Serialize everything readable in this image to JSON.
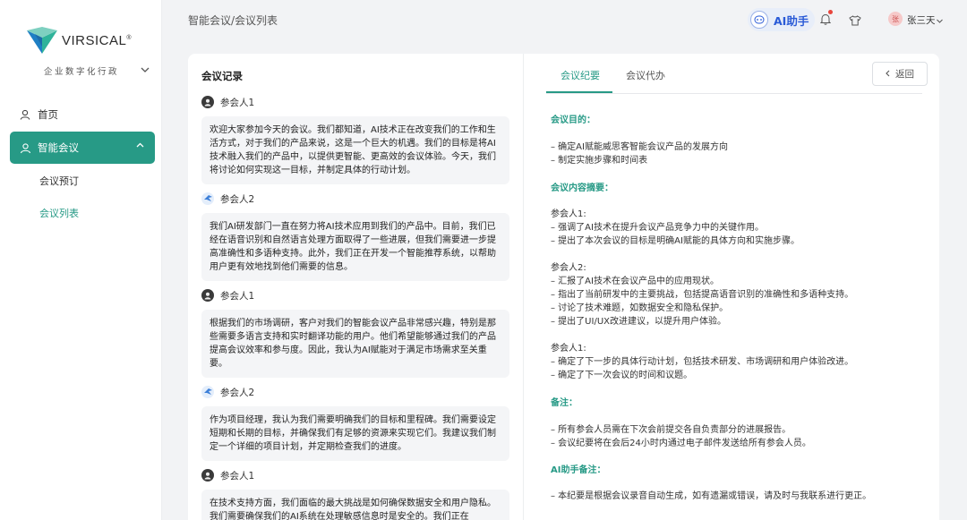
{
  "brand": {
    "name": "VIRSICAL",
    "reg": "®",
    "org": "企业数字化行政",
    "colors": {
      "accent": "#279a86",
      "ai": "#2a5bd7"
    }
  },
  "nav": {
    "home": "首页",
    "meeting": "智能会议",
    "sub": [
      "会议预订",
      "会议列表"
    ]
  },
  "header": {
    "breadcrumb": "智能会议/会议列表",
    "ai_label": "AI助手",
    "avatar_text": "张",
    "user": "张三天"
  },
  "record": {
    "title": "会议记录",
    "messages": [
      {
        "speaker": "参会人1",
        "text": "欢迎大家参加今天的会议。我们都知道，AI技术正在改变我们的工作和生活方式，对于我们的产品来说，这是一个巨大的机遇。我们的目标是将AI技术融入我们的产品中，以提供更智能、更高效的会议体验。今天，我们将讨论如何实现这一目标，并制定具体的行动计划。"
      },
      {
        "speaker": "参会人2",
        "text": "我们AI研发部门一直在努力将AI技术应用到我们的产品中。目前，我们已经在语音识别和自然语言处理方面取得了一些进展，但我们需要进一步提高准确性和多语种支持。此外，我们正在开发一个智能推荐系统，以帮助用户更有效地找到他们需要的信息。"
      },
      {
        "speaker": "参会人1",
        "text": "根据我们的市场调研，客户对我们的智能会议产品非常感兴趣，特别是那些需要多语言支持和实时翻译功能的用户。他们希望能够通过我们的产品提高会议效率和参与度。因此，我认为AI赋能对于满足市场需求至关重要。"
      },
      {
        "speaker": "参会人2",
        "text": "作为项目经理，我认为我们需要明确我们的目标和里程碑。我们需要设定短期和长期的目标，并确保我们有足够的资源来实现它们。我建议我们制定一个详细的项目计划，并定期检查我们的进度。"
      },
      {
        "speaker": "参会人1",
        "text": "在技术支持方面，我们面临的最大挑战是如何确保数据安全和用户隐私。我们需要确保我们的AI系统在处理敏感信息时是安全的。我们正在"
      }
    ]
  },
  "minutes": {
    "tabs": [
      "会议纪要",
      "会议代办"
    ],
    "back": "返回",
    "sections": [
      {
        "title": "会议目的："
      },
      {
        "title": "会议内容摘要："
      },
      {
        "title": "备注："
      },
      {
        "title": "AI助手备注："
      }
    ],
    "purpose": [
      "– 确定AI赋能威思客智能会议产品的发展方向",
      "– 制定实施步骤和时间表"
    ],
    "summary": [
      "参会人1:",
      "– 强调了AI技术在提升会议产品竞争力中的关键作用。",
      "– 提出了本次会议的目标是明确AI赋能的具体方向和实施步骤。",
      "参会人2:",
      "– 汇报了AI技术在会议产品中的应用现状。",
      "– 指出了当前研发中的主要挑战，包括提高语音识别的准确性和多语种支持。",
      "– 讨论了技术难题，如数据安全和隐私保护。",
      "– 提出了UI/UX改进建议，以提升用户体验。",
      "参会人1:",
      "– 确定了下一步的具体行动计划，包括技术研发、市场调研和用户体验改进。",
      "– 确定了下一次会议的时间和议题。"
    ],
    "notes": [
      "– 所有参会人员需在下次会前提交各自负责部分的进展报告。",
      "– 会议纪要将在会后24小时内通过电子邮件发送给所有参会人员。"
    ],
    "ai_notes": [
      "– 本纪要是根据会议录音自动生成，如有遗漏或错误，请及时与我联系进行更正。"
    ]
  }
}
